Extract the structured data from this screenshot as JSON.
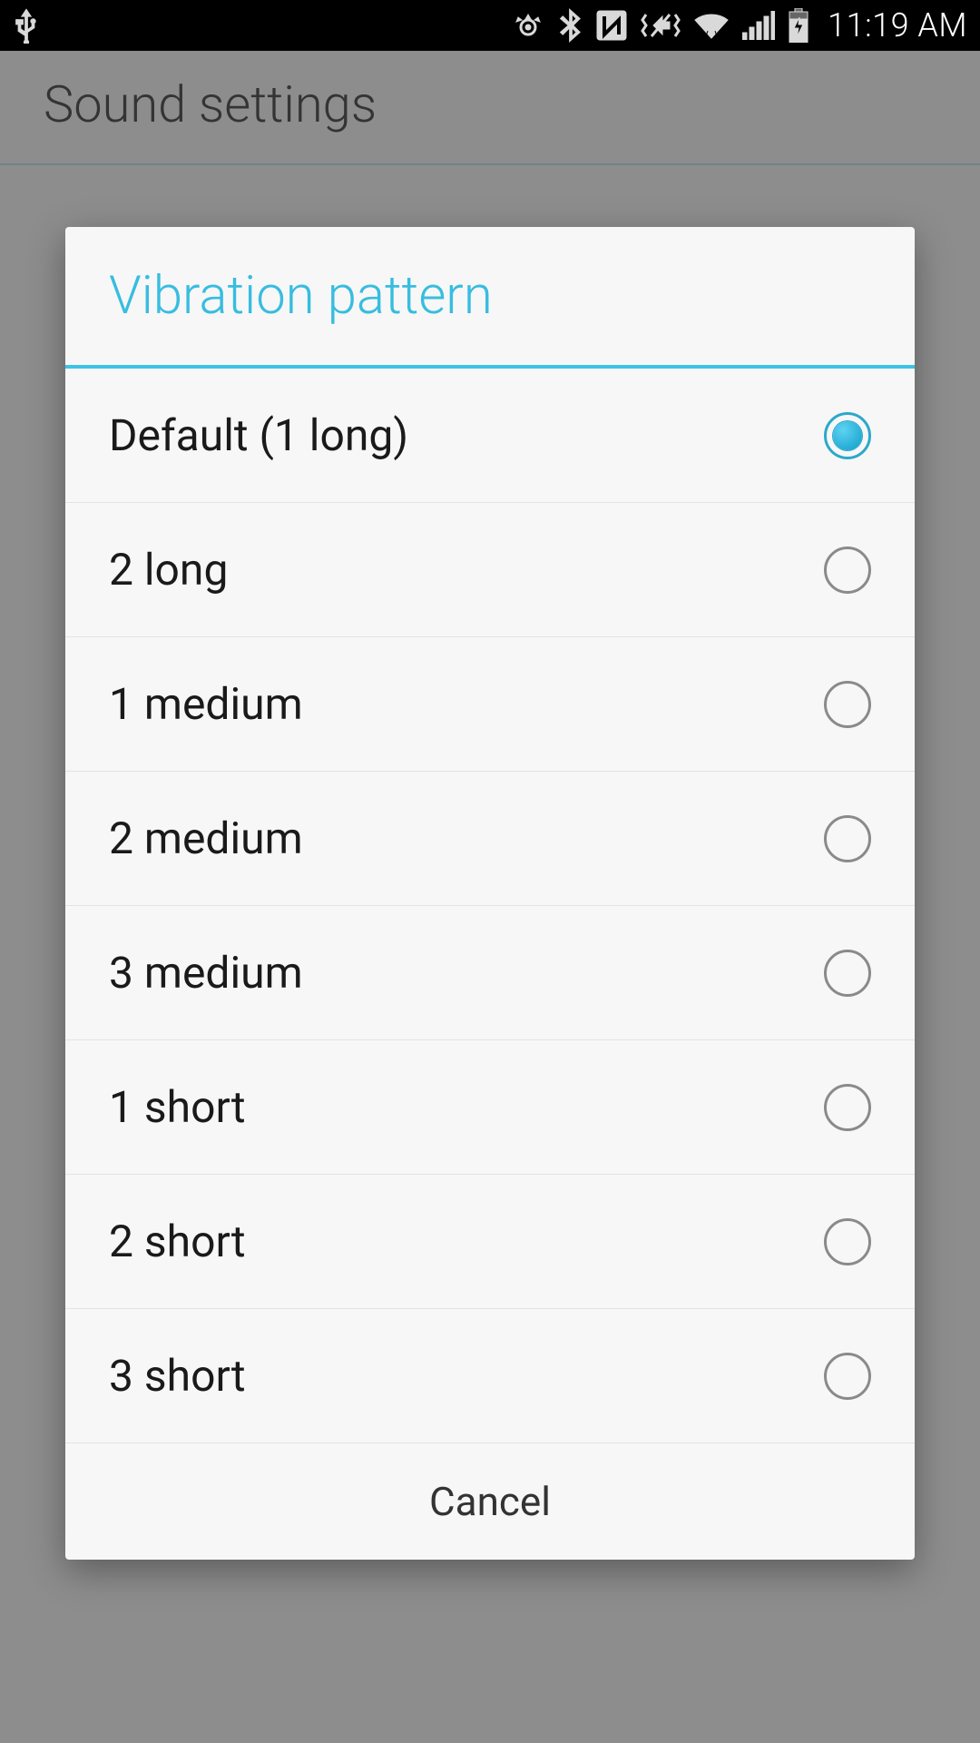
{
  "status": {
    "time": "11:19 AM"
  },
  "background": {
    "title": "Sound settings"
  },
  "dialog": {
    "title": "Vibration pattern",
    "options": [
      {
        "label": "Default (1 long)",
        "selected": true
      },
      {
        "label": "2 long",
        "selected": false
      },
      {
        "label": "1 medium",
        "selected": false
      },
      {
        "label": "2 medium",
        "selected": false
      },
      {
        "label": "3 medium",
        "selected": false
      },
      {
        "label": "1 short",
        "selected": false
      },
      {
        "label": "2 short",
        "selected": false
      },
      {
        "label": "3 short",
        "selected": false
      }
    ],
    "cancel_label": "Cancel"
  },
  "colors": {
    "accent": "#37bde0"
  }
}
